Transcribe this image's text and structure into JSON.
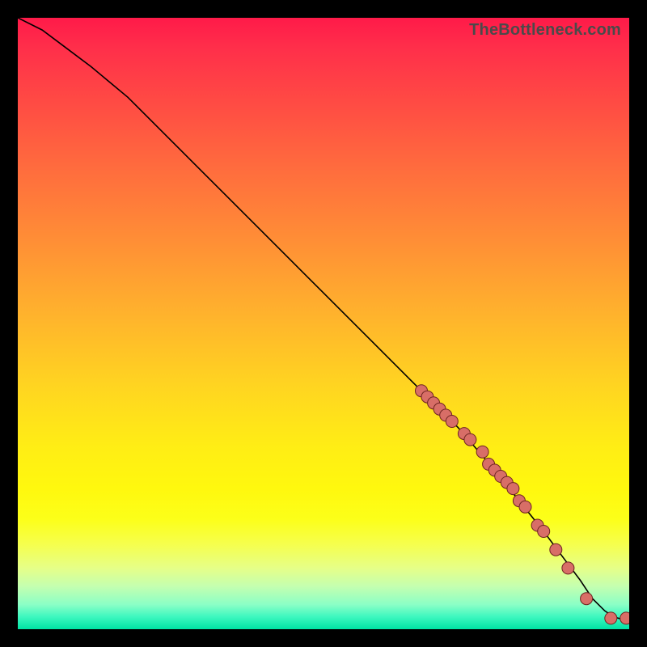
{
  "watermark": "TheBottleneck.com",
  "colors": {
    "point_fill": "#d86e67",
    "point_stroke": "#6e2420",
    "curve": "#000000"
  },
  "chart_data": {
    "type": "line",
    "title": "",
    "xlabel": "",
    "ylabel": "",
    "xlim": [
      0,
      100
    ],
    "ylim": [
      0,
      100
    ],
    "grid": false,
    "legend": null,
    "series": [
      {
        "name": "curve",
        "kind": "line",
        "x": [
          0,
          4,
          8,
          12,
          18,
          26,
          34,
          42,
          50,
          58,
          66,
          72,
          78,
          82,
          86,
          89,
          92,
          94,
          96,
          97.5,
          99,
          100
        ],
        "y": [
          100,
          98,
          95,
          92,
          87,
          79,
          71,
          63,
          55,
          47,
          39,
          33,
          26,
          21,
          16,
          12,
          8,
          5,
          3,
          2,
          1.6,
          1.6
        ]
      },
      {
        "name": "points",
        "kind": "scatter",
        "x": [
          66,
          67,
          68,
          69,
          70,
          71,
          73,
          74,
          76,
          77,
          78,
          79,
          80,
          81,
          82,
          83,
          85,
          86,
          88,
          90,
          93,
          97,
          99.5
        ],
        "y": [
          39,
          38,
          37,
          36,
          35,
          34,
          32,
          31,
          29,
          27,
          26,
          25,
          24,
          23,
          21,
          20,
          17,
          16,
          13,
          10,
          5,
          1.8,
          1.8
        ]
      }
    ]
  }
}
